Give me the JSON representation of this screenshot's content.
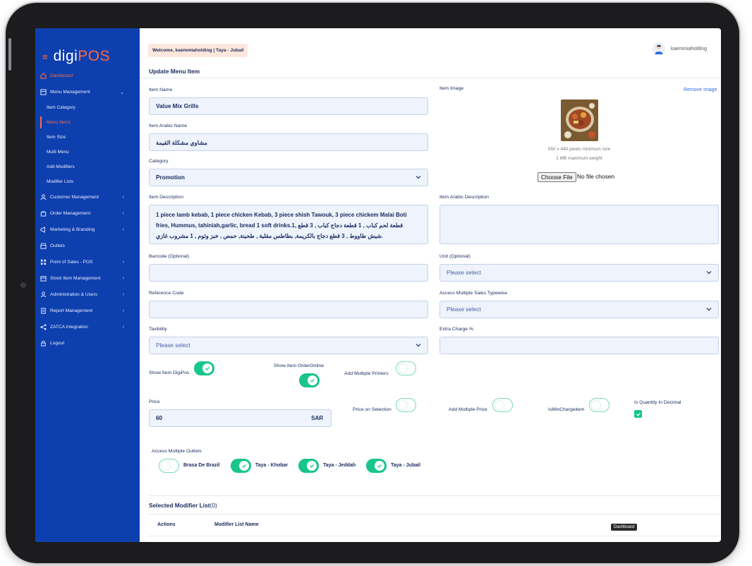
{
  "brand": {
    "name_part1": "digi",
    "name_part2": "POS"
  },
  "sidebar": {
    "items": [
      {
        "label": "Dashboard",
        "icon": "home-icon"
      },
      {
        "label": "Menu Management",
        "icon": "book-icon"
      },
      {
        "label": "Customer Management",
        "icon": "users-icon"
      },
      {
        "label": "Order Management",
        "icon": "bag-icon"
      },
      {
        "label": "Marketing & Branding",
        "icon": "megaphone-icon"
      },
      {
        "label": "Outlets",
        "icon": "store-icon"
      },
      {
        "label": "Point of Sales - POS",
        "icon": "grid-icon"
      },
      {
        "label": "Stock Item Management",
        "icon": "box-icon"
      },
      {
        "label": "Administration & Users",
        "icon": "user-icon"
      },
      {
        "label": "Report Management",
        "icon": "report-icon"
      },
      {
        "label": "ZATCA Integration",
        "icon": "share-icon"
      },
      {
        "label": "Logout",
        "icon": "lock-icon"
      }
    ],
    "submenu": [
      "Item Category",
      "Menu Items",
      "Item Size",
      "Multi Menu",
      "Add Modifiers",
      "Modifier Lists"
    ]
  },
  "header": {
    "welcome": "Welcome, kaemmiaholding | Taya - Jubail",
    "username": "kaemmiaholding"
  },
  "page": {
    "title": "Update Menu Item"
  },
  "form": {
    "item_name_label": "Item Name",
    "item_name_value": "Value Mix Grills",
    "item_arabic_name_label": "Item Arabic Name",
    "item_arabic_name_value": "مشاوي مشكلة القيمة",
    "category_label": "Category",
    "category_value": "Promotion",
    "item_description_label": "Item Description",
    "item_description_line1": "1 piece lamb kebab, 1 piece chicken Kebab, 3 piece shish Tawouk, 3 piece chickem Malai Boti",
    "item_description_line2": "fries, Hummus, tahiniah,garlic, bread 1 soft drinks.1, قطعة لحم كباب , 1 قطعة دجاج كباب , 3 قطع",
    "item_description_line3": ".شيش طاووط , 3 قطع دجاج بالكريمة, بطاطس مقلية , طحينة, حمص , خبز وثوم , 1 مشروب غازي",
    "item_image_label": "Item Image",
    "remove_image": "Remove Image",
    "image_hint1": "550 x 440 pixels minimum size",
    "image_hint2": "1 MB maximum weight",
    "choose_file": "Choose File",
    "no_file": "No file chosen",
    "item_arabic_description_label": "Item Arabic Description",
    "barcode_label": "Barcode (Optional)",
    "unit_label": "Unit (Optional)",
    "unit_placeholder": "Please select",
    "reference_code_label": "Reference Code",
    "access_sales_label": "Access Multiple Sales Typewise",
    "access_sales_placeholder": "Please select",
    "taxibility_label": "Taxibility",
    "taxibility_placeholder": "Please select",
    "extra_charge_label": "Extra Charge %",
    "show_item_digipos": "Show Item DigiPos",
    "show_item_orderonline": "Show Item OrderOnline",
    "add_multiple_printers": "Add Multiple Printers",
    "price_label": "Price",
    "price_value": "60",
    "price_unit": "SAR",
    "price_on_selection": "Price on Selection",
    "add_multiple_price": "Add Multiple Price",
    "is_min_charge": "IsMinChargeitem",
    "is_quantity_decimal": "Is Quantity In Decimal",
    "access_outlets_label": "Access Multiple Outlets",
    "outlets": [
      "Brasa De Brazil",
      "Taya - Khobar",
      "Taya - Jeddah",
      "Taya - Jubail"
    ]
  },
  "modifiers": {
    "title": "Selected Modifier List",
    "count": "(0)",
    "col_actions": "Actions",
    "col_name": "Modifier List Name"
  },
  "tooltip": "Dashboard",
  "toggles": {
    "show_item_digipos": true,
    "show_item_orderonline": true,
    "add_multiple_printers": false,
    "price_on_selection": false,
    "add_multiple_price": false,
    "is_min_charge": false,
    "is_quantity_decimal": true,
    "outlets": [
      false,
      true,
      true,
      true
    ]
  },
  "colors": {
    "sidebar": "#0e3fae",
    "accent": "#ff6a3d",
    "toggle_on": "#17c58d"
  }
}
